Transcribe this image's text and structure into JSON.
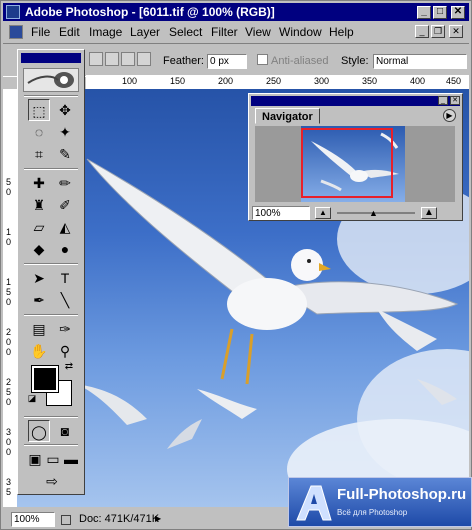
{
  "window": {
    "app_name": "Adobe Photoshop",
    "document_title": "[6011.tif @ 100% (RGB)]",
    "title_separator": " - "
  },
  "menu": {
    "items": [
      {
        "label": "File",
        "key": "file"
      },
      {
        "label": "Edit",
        "key": "edit"
      },
      {
        "label": "Image",
        "key": "image"
      },
      {
        "label": "Layer",
        "key": "layer"
      },
      {
        "label": "Select",
        "key": "select"
      },
      {
        "label": "Filter",
        "key": "filter"
      },
      {
        "label": "View",
        "key": "view"
      },
      {
        "label": "Window",
        "key": "window"
      },
      {
        "label": "Help",
        "key": "help"
      }
    ]
  },
  "options": {
    "feather_label": "Feather:",
    "feather_value": "0 px",
    "antialias_label": "Anti-aliased",
    "style_label": "Style:",
    "style_value": "Normal"
  },
  "rulers": {
    "horizontal": [
      "100",
      "150",
      "200",
      "250",
      "300",
      "350",
      "400",
      "450"
    ],
    "vertical": [
      "5",
      "0",
      "1",
      "0",
      "1",
      "5",
      "0",
      "2",
      "0",
      "0",
      "2",
      "5",
      "0",
      "3",
      "0",
      "0",
      "3",
      "5"
    ]
  },
  "navigator": {
    "tab_label": "Navigator",
    "zoom_value": "100%"
  },
  "status": {
    "zoom": "100%",
    "doc_info": "Doc: 471K/471K"
  },
  "watermark": {
    "main": "Full-Photoshop.ru",
    "sub": "Всё для Photoshop"
  },
  "colors": {
    "titlebar": "#000080",
    "navigator_view_box": "#e8202a",
    "sky": "#3d6fc8"
  }
}
